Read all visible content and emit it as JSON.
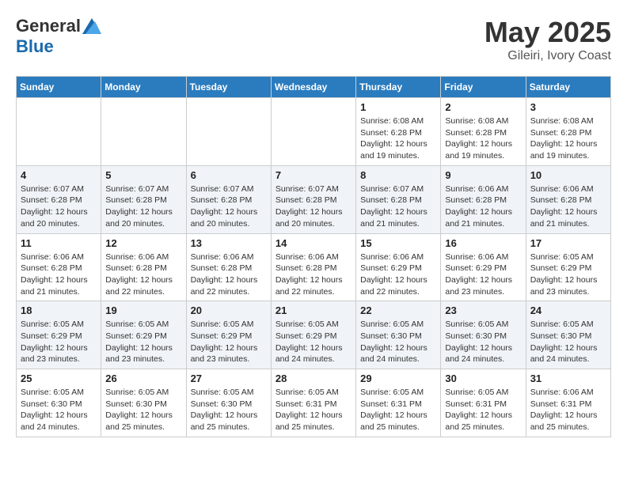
{
  "header": {
    "logo_general": "General",
    "logo_blue": "Blue",
    "month": "May 2025",
    "location": "Gileiri, Ivory Coast"
  },
  "weekdays": [
    "Sunday",
    "Monday",
    "Tuesday",
    "Wednesday",
    "Thursday",
    "Friday",
    "Saturday"
  ],
  "weeks": [
    [
      {
        "day": "",
        "info": ""
      },
      {
        "day": "",
        "info": ""
      },
      {
        "day": "",
        "info": ""
      },
      {
        "day": "",
        "info": ""
      },
      {
        "day": "1",
        "info": "Sunrise: 6:08 AM\nSunset: 6:28 PM\nDaylight: 12 hours\nand 19 minutes."
      },
      {
        "day": "2",
        "info": "Sunrise: 6:08 AM\nSunset: 6:28 PM\nDaylight: 12 hours\nand 19 minutes."
      },
      {
        "day": "3",
        "info": "Sunrise: 6:08 AM\nSunset: 6:28 PM\nDaylight: 12 hours\nand 19 minutes."
      }
    ],
    [
      {
        "day": "4",
        "info": "Sunrise: 6:07 AM\nSunset: 6:28 PM\nDaylight: 12 hours\nand 20 minutes."
      },
      {
        "day": "5",
        "info": "Sunrise: 6:07 AM\nSunset: 6:28 PM\nDaylight: 12 hours\nand 20 minutes."
      },
      {
        "day": "6",
        "info": "Sunrise: 6:07 AM\nSunset: 6:28 PM\nDaylight: 12 hours\nand 20 minutes."
      },
      {
        "day": "7",
        "info": "Sunrise: 6:07 AM\nSunset: 6:28 PM\nDaylight: 12 hours\nand 20 minutes."
      },
      {
        "day": "8",
        "info": "Sunrise: 6:07 AM\nSunset: 6:28 PM\nDaylight: 12 hours\nand 21 minutes."
      },
      {
        "day": "9",
        "info": "Sunrise: 6:06 AM\nSunset: 6:28 PM\nDaylight: 12 hours\nand 21 minutes."
      },
      {
        "day": "10",
        "info": "Sunrise: 6:06 AM\nSunset: 6:28 PM\nDaylight: 12 hours\nand 21 minutes."
      }
    ],
    [
      {
        "day": "11",
        "info": "Sunrise: 6:06 AM\nSunset: 6:28 PM\nDaylight: 12 hours\nand 21 minutes."
      },
      {
        "day": "12",
        "info": "Sunrise: 6:06 AM\nSunset: 6:28 PM\nDaylight: 12 hours\nand 22 minutes."
      },
      {
        "day": "13",
        "info": "Sunrise: 6:06 AM\nSunset: 6:28 PM\nDaylight: 12 hours\nand 22 minutes."
      },
      {
        "day": "14",
        "info": "Sunrise: 6:06 AM\nSunset: 6:28 PM\nDaylight: 12 hours\nand 22 minutes."
      },
      {
        "day": "15",
        "info": "Sunrise: 6:06 AM\nSunset: 6:29 PM\nDaylight: 12 hours\nand 22 minutes."
      },
      {
        "day": "16",
        "info": "Sunrise: 6:06 AM\nSunset: 6:29 PM\nDaylight: 12 hours\nand 23 minutes."
      },
      {
        "day": "17",
        "info": "Sunrise: 6:05 AM\nSunset: 6:29 PM\nDaylight: 12 hours\nand 23 minutes."
      }
    ],
    [
      {
        "day": "18",
        "info": "Sunrise: 6:05 AM\nSunset: 6:29 PM\nDaylight: 12 hours\nand 23 minutes."
      },
      {
        "day": "19",
        "info": "Sunrise: 6:05 AM\nSunset: 6:29 PM\nDaylight: 12 hours\nand 23 minutes."
      },
      {
        "day": "20",
        "info": "Sunrise: 6:05 AM\nSunset: 6:29 PM\nDaylight: 12 hours\nand 23 minutes."
      },
      {
        "day": "21",
        "info": "Sunrise: 6:05 AM\nSunset: 6:29 PM\nDaylight: 12 hours\nand 24 minutes."
      },
      {
        "day": "22",
        "info": "Sunrise: 6:05 AM\nSunset: 6:30 PM\nDaylight: 12 hours\nand 24 minutes."
      },
      {
        "day": "23",
        "info": "Sunrise: 6:05 AM\nSunset: 6:30 PM\nDaylight: 12 hours\nand 24 minutes."
      },
      {
        "day": "24",
        "info": "Sunrise: 6:05 AM\nSunset: 6:30 PM\nDaylight: 12 hours\nand 24 minutes."
      }
    ],
    [
      {
        "day": "25",
        "info": "Sunrise: 6:05 AM\nSunset: 6:30 PM\nDaylight: 12 hours\nand 24 minutes."
      },
      {
        "day": "26",
        "info": "Sunrise: 6:05 AM\nSunset: 6:30 PM\nDaylight: 12 hours\nand 25 minutes."
      },
      {
        "day": "27",
        "info": "Sunrise: 6:05 AM\nSunset: 6:30 PM\nDaylight: 12 hours\nand 25 minutes."
      },
      {
        "day": "28",
        "info": "Sunrise: 6:05 AM\nSunset: 6:31 PM\nDaylight: 12 hours\nand 25 minutes."
      },
      {
        "day": "29",
        "info": "Sunrise: 6:05 AM\nSunset: 6:31 PM\nDaylight: 12 hours\nand 25 minutes."
      },
      {
        "day": "30",
        "info": "Sunrise: 6:05 AM\nSunset: 6:31 PM\nDaylight: 12 hours\nand 25 minutes."
      },
      {
        "day": "31",
        "info": "Sunrise: 6:06 AM\nSunset: 6:31 PM\nDaylight: 12 hours\nand 25 minutes."
      }
    ]
  ]
}
